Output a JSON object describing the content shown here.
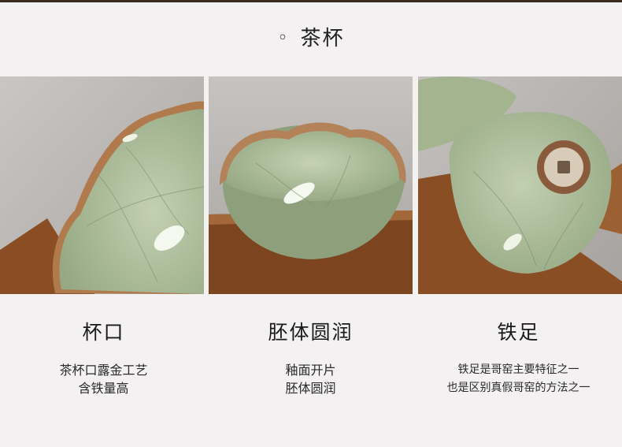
{
  "section": {
    "bullet": "◦",
    "title": "茶杯"
  },
  "features": [
    {
      "heading": "杯口",
      "lines": [
        "茶杯口露金工艺",
        "含铁量高"
      ]
    },
    {
      "heading": "胚体圆润",
      "lines": [
        "釉面开片",
        "胚体圆润"
      ]
    },
    {
      "heading": "铁足",
      "lines": [
        "铁足是哥窑主要特征之一",
        "也是区别真假哥窑的方法之一"
      ]
    }
  ],
  "colors": {
    "background": "#f4f1f2",
    "glaze": "#a8b995",
    "wood": "#9a5a2c"
  }
}
